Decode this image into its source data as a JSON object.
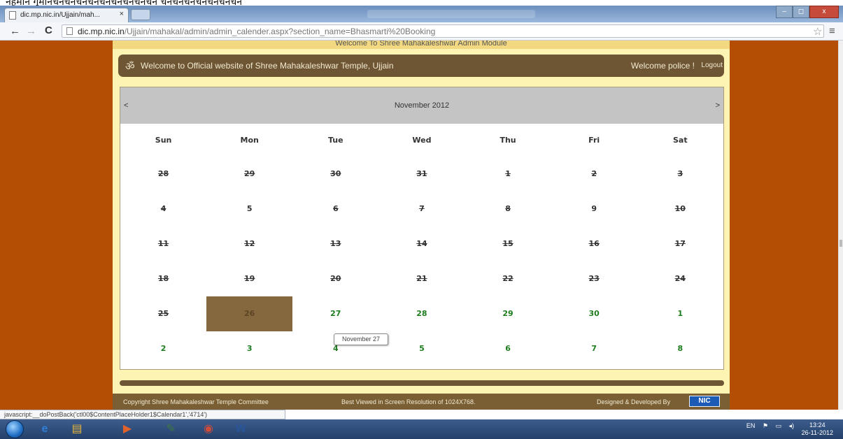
{
  "top_strip": {
    "text": "नेहुमान गुमानचनचनचनचनचनचनचनचनचन चनचनचनचनचनचनचन"
  },
  "browser": {
    "tab_title": "dic.mp.nic.in/Ujjain/mah...",
    "tab_close": "×",
    "url_host": "dic.mp.nic.in",
    "url_path": "/Ujjain/mahakal/admin/admin_calender.aspx?section_name=Bhasmarti%20Booking",
    "nav": {
      "back": "←",
      "forward": "→",
      "reload": "C"
    },
    "star": "☆",
    "menu": "≡",
    "window_buttons": {
      "minimize": "–",
      "maximize": "◻",
      "close": "x"
    }
  },
  "site": {
    "admin_banner": "Welcome To Shree Mahakaleshwar Admin Module",
    "om_symbol": "ॐ",
    "welcome_site": "Welcome to Official website of Shree Mahakaleshwar Temple, Ujjain",
    "welcome_user": "Welcome police !",
    "logout": "Logout"
  },
  "calendar": {
    "month_label": "November 2012",
    "prev": "<",
    "next": ">",
    "weekdays": [
      "Sun",
      "Mon",
      "Tue",
      "Wed",
      "Thu",
      "Fri",
      "Sat"
    ],
    "weeks": [
      [
        {
          "d": "28",
          "s": "past"
        },
        {
          "d": "29",
          "s": "past"
        },
        {
          "d": "30",
          "s": "past"
        },
        {
          "d": "31",
          "s": "past"
        },
        {
          "d": "1",
          "s": "past"
        },
        {
          "d": "2",
          "s": "past"
        },
        {
          "d": "3",
          "s": "past"
        }
      ],
      [
        {
          "d": "4",
          "s": "past"
        },
        {
          "d": "5",
          "s": "plain"
        },
        {
          "d": "6",
          "s": "past"
        },
        {
          "d": "7",
          "s": "past"
        },
        {
          "d": "8",
          "s": "past"
        },
        {
          "d": "9",
          "s": "plain"
        },
        {
          "d": "10",
          "s": "past"
        }
      ],
      [
        {
          "d": "11",
          "s": "past"
        },
        {
          "d": "12",
          "s": "past"
        },
        {
          "d": "13",
          "s": "past"
        },
        {
          "d": "14",
          "s": "past"
        },
        {
          "d": "15",
          "s": "past"
        },
        {
          "d": "16",
          "s": "past"
        },
        {
          "d": "17",
          "s": "past"
        }
      ],
      [
        {
          "d": "18",
          "s": "past"
        },
        {
          "d": "19",
          "s": "past"
        },
        {
          "d": "20",
          "s": "past"
        },
        {
          "d": "21",
          "s": "past"
        },
        {
          "d": "22",
          "s": "past"
        },
        {
          "d": "23",
          "s": "past"
        },
        {
          "d": "24",
          "s": "past"
        }
      ],
      [
        {
          "d": "25",
          "s": "past"
        },
        {
          "d": "26",
          "s": "today"
        },
        {
          "d": "27",
          "s": "avail"
        },
        {
          "d": "28",
          "s": "avail"
        },
        {
          "d": "29",
          "s": "avail"
        },
        {
          "d": "30",
          "s": "avail"
        },
        {
          "d": "1",
          "s": "next"
        }
      ],
      [
        {
          "d": "2",
          "s": "next"
        },
        {
          "d": "3",
          "s": "next"
        },
        {
          "d": "4",
          "s": "next"
        },
        {
          "d": "5",
          "s": "next"
        },
        {
          "d": "6",
          "s": "next"
        },
        {
          "d": "7",
          "s": "next"
        },
        {
          "d": "8",
          "s": "next"
        }
      ]
    ],
    "tooltip": "November 27"
  },
  "footer": {
    "copyright": "Copyright Shree Mahakaleshwar Temple Committee",
    "resolution": "Best Viewed in Screen Resolution of 1024X768.",
    "designed": "Designed & Developed By",
    "nic_logo": "NIC"
  },
  "status_bar": "javascript:__doPostBack('ctl00$ContentPlaceHolder1$Calendar1','4714')",
  "taskbar": {
    "apps": [
      {
        "name": "ie-icon",
        "glyph": "e",
        "color": "#2f7fd6"
      },
      {
        "name": "explorer-icon",
        "glyph": "▤",
        "color": "#e3b33b"
      },
      {
        "name": "media-player-icon",
        "glyph": "▶",
        "color": "#e0622b"
      },
      {
        "name": "app-icon",
        "glyph": "✎",
        "color": "#3f7a3f"
      },
      {
        "name": "chrome-icon",
        "glyph": "◉",
        "color": "#d14b3a"
      },
      {
        "name": "word-icon",
        "glyph": "W",
        "color": "#2a5699"
      }
    ],
    "tray_lang": "EN",
    "time": "13:24",
    "date": "26-11-2012"
  },
  "colors": {
    "page_background": "#b44e05",
    "header_brown": "#6e5533",
    "container_yellow": "#fdf3b3",
    "selected_day": "#86683f",
    "available_day_text": "#1e7d1e"
  }
}
